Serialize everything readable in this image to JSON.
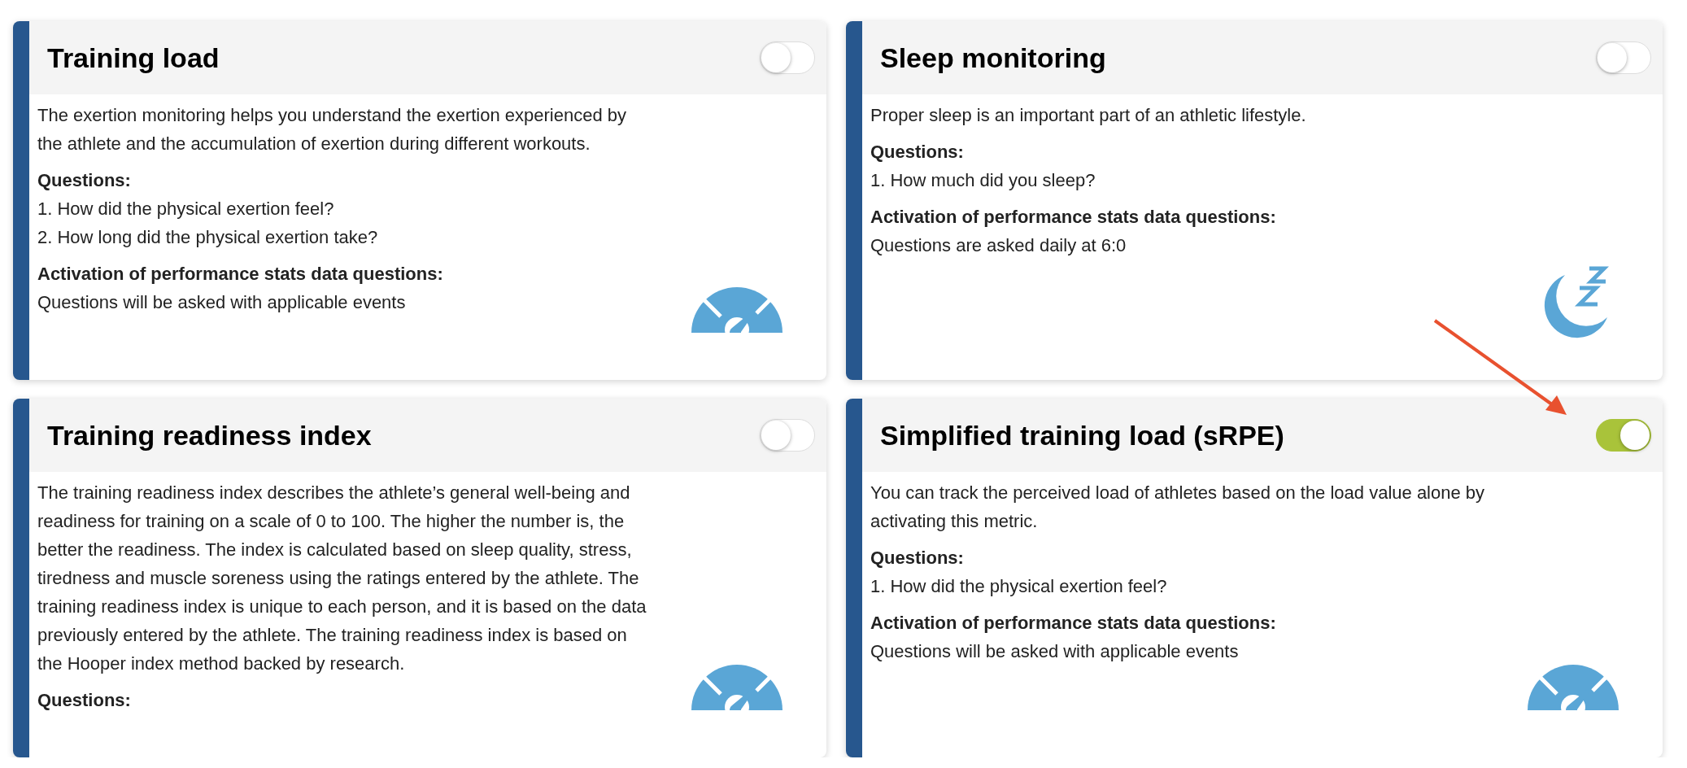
{
  "cards": [
    {
      "title": "Training load",
      "enabled": false,
      "pointed_at": false,
      "kind": "gauge",
      "description": "The exertion monitoring helps you understand the exertion experienced by the athlete and the accumulation of exertion during different workouts.",
      "questions_label": "Questions:",
      "questions": [
        "1. How did the physical exertion feel?",
        "2. How long did the physical exertion take?"
      ],
      "activation_label": "Activation of performance stats data questions:",
      "activation": "Questions will be asked with applicable events"
    },
    {
      "title": "Sleep monitoring",
      "enabled": false,
      "pointed_at": false,
      "kind": "moon",
      "description": "Proper sleep is an important part of an athletic lifestyle.",
      "questions_label": "Questions:",
      "questions": [
        "1. How much did you sleep?"
      ],
      "activation_label": "Activation of performance stats data questions:",
      "activation": "Questions are asked daily at 6:0"
    },
    {
      "title": "Training readiness index",
      "enabled": false,
      "pointed_at": false,
      "kind": "gauge",
      "description": "The training readiness index describes the athlete’s general well-being and readiness for training on a scale of 0 to 100. The higher the number is, the better the readiness. The index is calculated based on sleep quality, stress, tiredness and muscle soreness using the ratings entered by the athlete. The training readiness index is unique to each person, and it is based on the data previously entered by the athlete. The training readiness index is based on the Hooper index method backed by research.",
      "questions_label": "Questions:"
    },
    {
      "title": "Simplified training load (sRPE)",
      "enabled": true,
      "pointed_at": true,
      "kind": "gauge",
      "description": "You can track the perceived load of athletes based on the load value alone by activating this metric.",
      "questions_label": "Questions:",
      "questions": [
        "1. How did the physical exertion feel?"
      ],
      "activation_label": "Activation of performance stats data questions:",
      "activation": "Questions will be asked with applicable events"
    }
  ]
}
